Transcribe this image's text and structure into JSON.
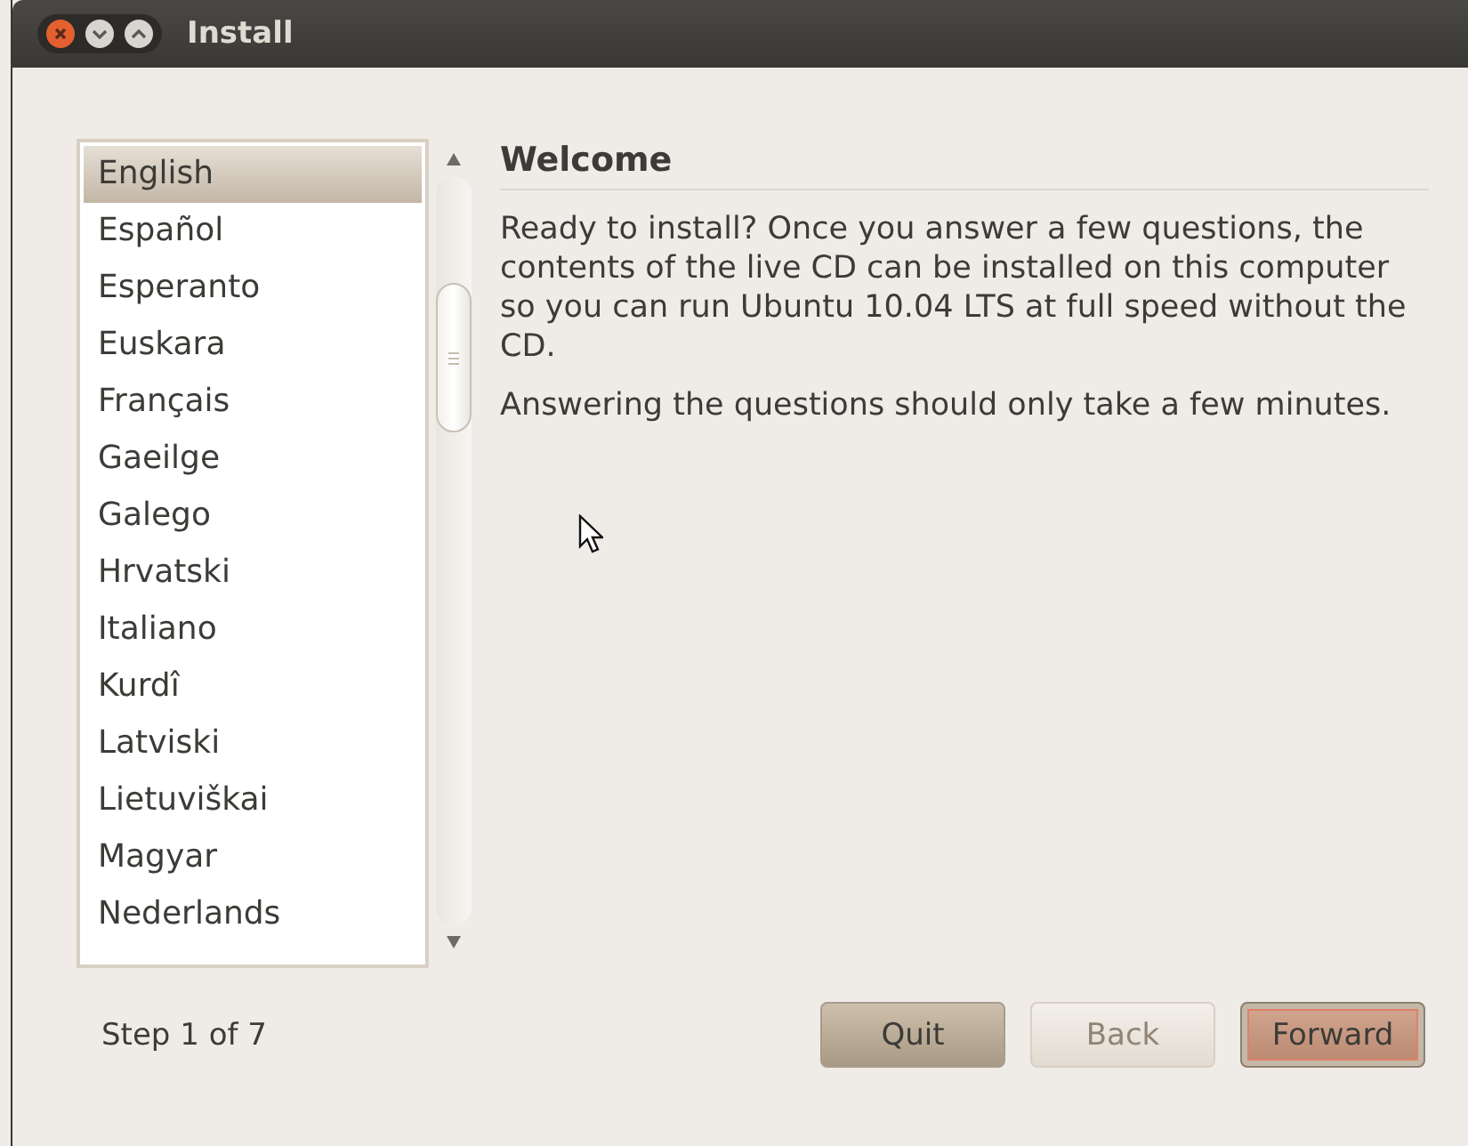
{
  "window": {
    "title": "Install"
  },
  "languages": [
    {
      "label": "English",
      "selected": true
    },
    {
      "label": "Español",
      "selected": false
    },
    {
      "label": "Esperanto",
      "selected": false
    },
    {
      "label": "Euskara",
      "selected": false
    },
    {
      "label": "Français",
      "selected": false
    },
    {
      "label": "Gaeilge",
      "selected": false
    },
    {
      "label": "Galego",
      "selected": false
    },
    {
      "label": "Hrvatski",
      "selected": false
    },
    {
      "label": "Italiano",
      "selected": false
    },
    {
      "label": "Kurdî",
      "selected": false
    },
    {
      "label": "Latviski",
      "selected": false
    },
    {
      "label": "Lietuviškai",
      "selected": false
    },
    {
      "label": "Magyar",
      "selected": false
    },
    {
      "label": "Nederlands",
      "selected": false
    }
  ],
  "heading": "Welcome",
  "paragraphs": [
    "Ready to install?  Once you answer a few questions, the contents of the live CD can be installed on this computer so you can run Ubuntu 10.04 LTS at full speed without the CD.",
    "Answering the questions should only take a few minutes."
  ],
  "step": "Step 1 of 7",
  "buttons": [
    {
      "label": "Quit",
      "disabled": false,
      "focused": false
    },
    {
      "label": "Back",
      "disabled": true,
      "focused": false
    },
    {
      "label": "Forward",
      "disabled": false,
      "focused": true
    }
  ]
}
